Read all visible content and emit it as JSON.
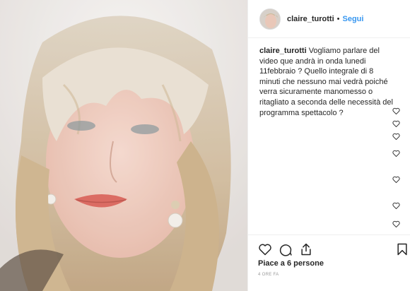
{
  "post": {
    "username": "claire_turotti",
    "separator": "•",
    "follow_label": "Segui",
    "caption_user": "claire_turotti",
    "caption_text": " Vogliamo parlare del video que andrà in onda lunedi 11febbraio ? Quello integrale di 8 minuti che nessuno mai vedrà poiché verra sicuramente manomesso o ritagliato a seconda delle necessità del programma spettacolo ?",
    "likes_text": "Piace a 6 persone",
    "time_text": "4 ORE FA"
  },
  "icons": {
    "like": "heart-icon",
    "comment": "comment-icon",
    "share": "share-icon",
    "save": "bookmark-icon",
    "mini_like": "heart-icon"
  },
  "colors": {
    "link": "#3897f0",
    "text": "#262626",
    "muted": "#999999",
    "border": "#efefef"
  }
}
